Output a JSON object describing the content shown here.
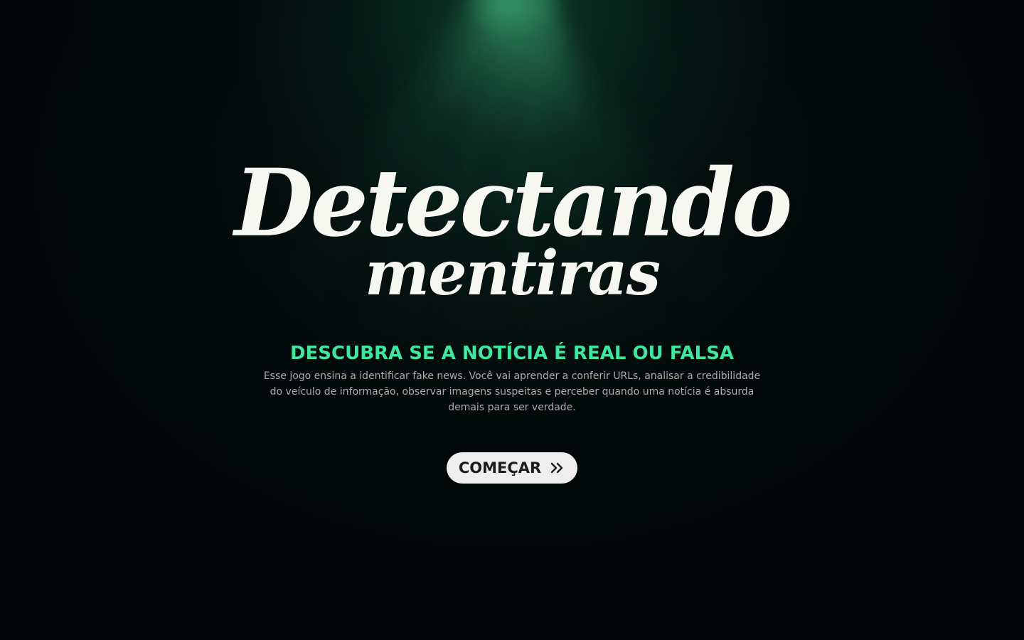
{
  "hero": {
    "logo_line1": "Detectando",
    "logo_line2": "mentiras",
    "subtitle": "DESCUBRA SE A NOTÍCIA É REAL OU FALSA",
    "description": "Esse jogo ensina a identificar fake news. Você vai aprender a conferir URLs, analisar a credibilidade do veículo de informação, observar imagens suspeitas e perceber quando uma notícia é absurda demais para ser verdade.",
    "start_button": {
      "label": "COMEÇAR",
      "icon": "double-chevron-right-icon"
    }
  },
  "colors": {
    "background": "#020507",
    "glow": "#125c3e",
    "subtitle": "#3ee6a0",
    "description": "#a9adab",
    "button_bg": "#eeeeee",
    "button_text": "#1c1c1c",
    "logo": "#f7f7f2"
  }
}
